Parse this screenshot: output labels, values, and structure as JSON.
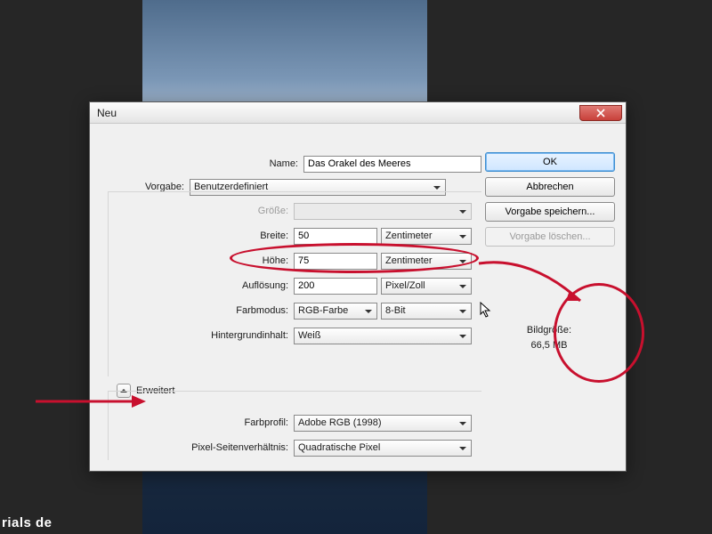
{
  "dialog": {
    "title": "Neu",
    "close_icon": "close-icon",
    "nameLabel": "Name:",
    "nameValue": "Das Orakel des Meeres",
    "presetLabel": "Vorgabe:",
    "presetValue": "Benutzerdefiniert",
    "sizeLabel": "Größe:",
    "widthLabel": "Breite:",
    "widthValue": "50",
    "widthUnit": "Zentimeter",
    "heightLabel": "Höhe:",
    "heightValue": "75",
    "heightUnit": "Zentimeter",
    "resLabel": "Auflösung:",
    "resValue": "200",
    "resUnit": "Pixel/Zoll",
    "colorModeLabel": "Farbmodus:",
    "colorModeValue": "RGB-Farbe",
    "colorDepthValue": "8-Bit",
    "bgLabel": "Hintergrundinhalt:",
    "bgValue": "Weiß",
    "advancedLabel": "Erweitert",
    "profileLabel": "Farbprofil:",
    "profileValue": "Adobe RGB (1998)",
    "aspectLabel": "Pixel-Seitenverhältnis:",
    "aspectValue": "Quadratische Pixel",
    "imageSizeLabel": "Bildgröße:",
    "imageSizeValue": "66,5 MB"
  },
  "buttons": {
    "ok": "OK",
    "cancel": "Abbrechen",
    "savePreset": "Vorgabe speichern...",
    "deletePreset": "Vorgabe löschen..."
  },
  "watermark": "rials de"
}
